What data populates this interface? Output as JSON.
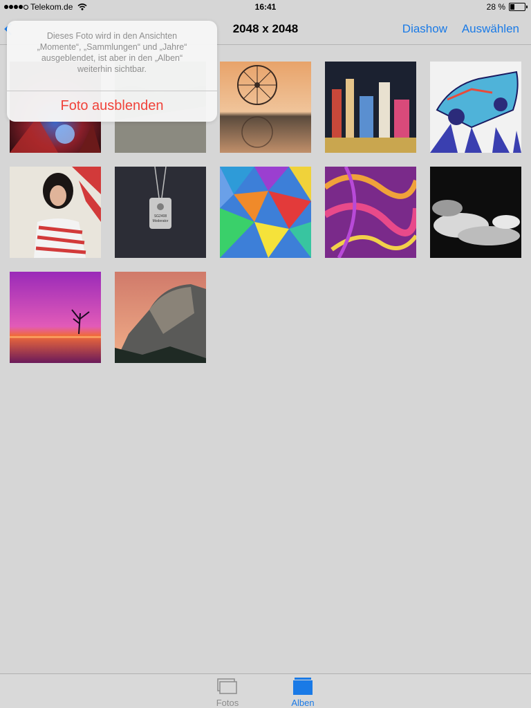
{
  "status": {
    "carrier": "Telekom.de",
    "time": "16:41",
    "battery_text": "28 %",
    "battery_level": 0.28,
    "signal_dots": 4
  },
  "nav": {
    "back_icon": "chevron-left-icon",
    "title": "2048 x 2048",
    "diashow": "Diashow",
    "auswaehlen": "Auswählen",
    "accent": "#1a7ae6"
  },
  "popover": {
    "message": "Dieses Foto wird in den Ansichten\n„Momente“, „Sammlungen“ und „Jahre“\nausgeblendet, ist aber in den „Alben“\nweiterhin sichtbar.",
    "action": "Foto ausblenden",
    "action_color": "#f0423a"
  },
  "photos": [
    {
      "name": "photo-spiderman"
    },
    {
      "name": "photo-gravel-path"
    },
    {
      "name": "photo-ferris-wheel"
    },
    {
      "name": "photo-city-night"
    },
    {
      "name": "photo-psychedelic-car"
    },
    {
      "name": "photo-woman-striped-dress"
    },
    {
      "name": "photo-dog-tag",
      "tag_lines": [
        "SG2408",
        "Moderator"
      ]
    },
    {
      "name": "photo-colorful-polygons"
    },
    {
      "name": "photo-colorful-swirls"
    },
    {
      "name": "photo-bw-clouds"
    },
    {
      "name": "photo-purple-sunset-tree"
    },
    {
      "name": "photo-half-dome"
    }
  ],
  "tabs": [
    {
      "label": "Fotos",
      "icon": "photos-stack-icon",
      "selected": false
    },
    {
      "label": "Alben",
      "icon": "album-icon",
      "selected": true
    }
  ]
}
